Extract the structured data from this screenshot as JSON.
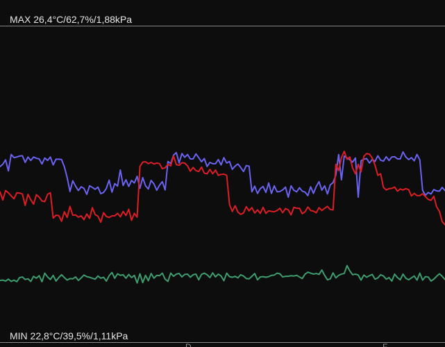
{
  "chart_data": {
    "type": "line",
    "max_label": "MAX 26,4°C/62,7%/1,88kPa",
    "min_label": "MIN 22,8°C/39,5%/1,11kPa",
    "x_ticks": [
      "D",
      "F"
    ],
    "grid": false,
    "legend": "none",
    "series": [
      {
        "color": "#6b63f2",
        "y": [
          55.5,
          56.2,
          57.6,
          54.1,
          59.3,
          58.3,
          58.5,
          58.8,
          58.9,
          56.8,
          58.5,
          57.4,
          58.5,
          58.1,
          57.9,
          56.3,
          58.2,
          57.4,
          58.5,
          56.0,
          57.8,
          57.8,
          57.7,
          55.4,
          52.0,
          47.6,
          51.0,
          49.3,
          47.9,
          49.1,
          48.6,
          46.7,
          49.4,
          48.9,
          48.3,
          49.0,
          46.9,
          47.3,
          48.6,
          51.2,
          47.4,
          50.1,
          49.3,
          54.4,
          49.5,
          51.3,
          49.2,
          51.1,
          50.3,
          52.4,
          48.6,
          52.0,
          49.4,
          48.4,
          51.1,
          50.0,
          48.0,
          49.6,
          50.7,
          48.1,
          57.1,
          56.4,
          59.1,
          59.9,
          56.6,
          59.6,
          58.4,
          59.3,
          57.9,
          57.9,
          59.5,
          58.3,
          57.0,
          58.0,
          55.5,
          56.8,
          56.4,
          56.4,
          57.7,
          56.0,
          58.3,
          56.6,
          57.1,
          54.6,
          55.6,
          56.3,
          55.2,
          53.9,
          55.8,
          55.6,
          47.5,
          49.3,
          47.0,
          48.5,
          49.2,
          47.3,
          50.3,
          47.0,
          49.4,
          47.5,
          47.6,
          48.1,
          49.0,
          45.8,
          49.4,
          48.0,
          47.5,
          48.8,
          47.7,
          47.4,
          46.3,
          49.1,
          47.0,
          49.2,
          50.7,
          48.0,
          49.4,
          46.8,
          49.7,
          50.4,
          52.8,
          59.3,
          51.3,
          58.8,
          58.2,
          57.6,
          56.9,
          58.2,
          45.8,
          57.3,
          57.8,
          58.0,
          56.6,
          57.7,
          57.1,
          58.9,
          57.5,
          57.2,
          58.6,
          57.4,
          58.5,
          58.6,
          57.9,
          57.9,
          60.1,
          58.5,
          57.7,
          58.3,
          57.3,
          59.3,
          57.6,
          48.0,
          46.4,
          47.3,
          46.8,
          48.2,
          47.8,
          47.7,
          48.9,
          47.9
        ]
      },
      {
        "color": "#dd1f25",
        "y": [
          47.5,
          44.9,
          47.9,
          47.2,
          46.2,
          45.3,
          47.2,
          47.1,
          46.8,
          43.2,
          46.7,
          45.0,
          43.6,
          46.6,
          45.8,
          44.6,
          44.4,
          46.7,
          47.2,
          39.2,
          40.1,
          40.0,
          38.2,
          41.2,
          39.4,
          42.9,
          40.1,
          40.2,
          39.5,
          39.9,
          38.7,
          40.5,
          39.1,
          42.5,
          40.3,
          39.8,
          37.9,
          40.9,
          39.7,
          39.4,
          39.9,
          39.9,
          40.7,
          39.6,
          41.3,
          40.0,
          42.0,
          38.5,
          40.7,
          39.5,
          55.5,
          56.9,
          57.0,
          56.4,
          56.8,
          56.3,
          56.6,
          56.4,
          54.8,
          55.1,
          56.2,
          55.7,
          58.8,
          56.1,
          55.9,
          56.7,
          56.6,
          55.7,
          54.0,
          55.2,
          54.2,
          53.9,
          55.3,
          53.4,
          53.2,
          54.6,
          53.2,
          54.4,
          52.7,
          53.0,
          53.1,
          52.7,
          43.5,
          41.3,
          43.1,
          41.1,
          40.4,
          40.8,
          42.8,
          41.5,
          42.5,
          40.8,
          41.8,
          40.7,
          42.6,
          40.7,
          41.5,
          41.3,
          41.2,
          41.6,
          42.3,
          40.9,
          42.2,
          41.8,
          40.2,
          42.6,
          42.3,
          42.3,
          40.6,
          41.2,
          42.7,
          41.6,
          41.4,
          40.9,
          42.5,
          41.6,
          42.3,
          42.9,
          41.9,
          41.8,
          56.2,
          54.2,
          58.3,
          60.3,
          57.8,
          58.5,
          55.0,
          53.2,
          56.2,
          53.8,
          58.7,
          59.6,
          59.4,
          58.2,
          55.9,
          52.7,
          53.2,
          48.9,
          48.1,
          48.5,
          48.6,
          49.0,
          47.7,
          48.4,
          48.1,
          48.5,
          48.2,
          46.2,
          47.0,
          46.3,
          46.3,
          46.9,
          46.0,
          45.1,
          44.8,
          46.1,
          42.8,
          41.3,
          38.1,
          37.1
        ]
      },
      {
        "color": "#3f9e6f",
        "y": [
          19.5,
          19.6,
          19.3,
          19.9,
          19.2,
          19.6,
          19.1,
          20.4,
          20.6,
          19.8,
          20.0,
          19.2,
          20.8,
          20.2,
          21.0,
          19.1,
          21.8,
          20.6,
          19.8,
          21.1,
          19.3,
          20.4,
          21.3,
          20.4,
          19.6,
          20.1,
          20.0,
          20.6,
          19.5,
          20.3,
          21.2,
          20.7,
          20.5,
          20.2,
          19.9,
          20.9,
          20.2,
          20.5,
          19.3,
          21.0,
          22.0,
          20.2,
          21.6,
          21.1,
          21.3,
          20.2,
          21.4,
          20.4,
          21.1,
          18.7,
          21.6,
          18.8,
          21.1,
          19.4,
          21.7,
          20.2,
          21.1,
          21.0,
          21.8,
          19.9,
          19.2,
          21.8,
          20.8,
          21.5,
          21.7,
          20.6,
          21.4,
          21.5,
          20.5,
          21.3,
          21.5,
          19.7,
          21.4,
          21.8,
          21.3,
          20.4,
          21.9,
          20.6,
          21.5,
          20.9,
          19.4,
          21.8,
          20.7,
          20.5,
          20.8,
          20.3,
          21.3,
          20.9,
          20.1,
          20.0,
          20.8,
          21.7,
          19.7,
          20.6,
          20.7,
          20.5,
          20.7,
          21.1,
          21.2,
          21.8,
          21.6,
          20.6,
          20.8,
          20.8,
          21.0,
          20.9,
          21.1,
          20.6,
          20.1,
          21.5,
          22.1,
          21.8,
          21.5,
          21.7,
          21.4,
          22.8,
          21.1,
          19.7,
          20.0,
          21.9,
          20.3,
          21.1,
          21.5,
          21.7,
          24.2,
          22.5,
          21.3,
          21.5,
          21.2,
          19.6,
          21.2,
          20.5,
          21.0,
          21.4,
          19.9,
          20.3,
          21.3,
          20.9,
          19.9,
          20.4,
          19.3,
          21.5,
          20.4,
          19.7,
          21.5,
          20.2,
          19.7,
          20.3,
          20.9,
          19.6,
          21.8,
          19.6,
          20.7,
          20.6,
          19.3,
          19.9,
          20.8,
          21.6,
          20.8,
          19.8
        ]
      }
    ],
    "ylim": [
      0,
      100
    ]
  }
}
